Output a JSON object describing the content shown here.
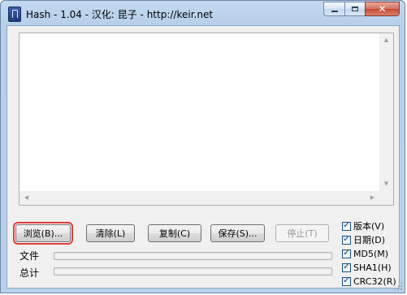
{
  "window": {
    "title": "Hash - 1.04 - 汉化: 昆子 - http://keir.net",
    "close_glyph": "✕"
  },
  "output": {
    "text": ""
  },
  "buttons": {
    "browse": "浏览(B)...",
    "clear": "清除(L)",
    "copy": "复制(C)",
    "save": "保存(S)...",
    "stop": "停止(T)"
  },
  "progress": {
    "file_label": "文件",
    "file_value": 0,
    "total_label": "总计",
    "total_value": 0
  },
  "options": [
    {
      "label": "版本(V)",
      "checked": true
    },
    {
      "label": "日期(D)",
      "checked": true
    },
    {
      "label": "MD5(M)",
      "checked": true
    },
    {
      "label": "SHA1(H)",
      "checked": true
    },
    {
      "label": "CRC32(R)",
      "checked": true
    }
  ],
  "colors": {
    "highlight": "#e23b3b",
    "progress_fill": "#06b025"
  }
}
